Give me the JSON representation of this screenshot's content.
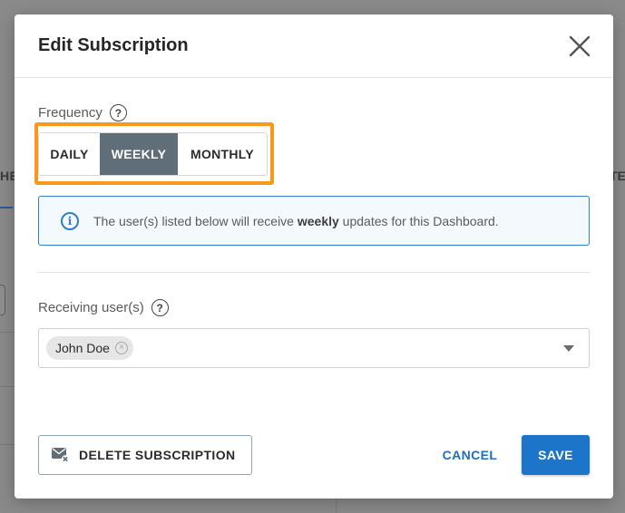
{
  "background": {
    "tab_left_fragment": "HE",
    "tab_right_fragment": "TE"
  },
  "modal": {
    "title": "Edit Subscription",
    "close_icon": "close-icon"
  },
  "frequency": {
    "label": "Frequency",
    "help": "?",
    "options": [
      "DAILY",
      "WEEKLY",
      "MONTHLY"
    ],
    "selected": "WEEKLY",
    "highlight_color": "#f6991e"
  },
  "info": {
    "text_before": "The user(s) listed below will receive ",
    "text_bold": "weekly",
    "text_after": " updates for this Dashboard.",
    "icon": "info-icon"
  },
  "receivers": {
    "label": "Receiving user(s)",
    "help": "?",
    "users": [
      "John Doe"
    ],
    "chip_remove": "×"
  },
  "actions": {
    "delete_label": "DELETE SUBSCRIPTION",
    "cancel_label": "CANCEL",
    "save_label": "SAVE",
    "accent_color": "#1c75c8"
  }
}
